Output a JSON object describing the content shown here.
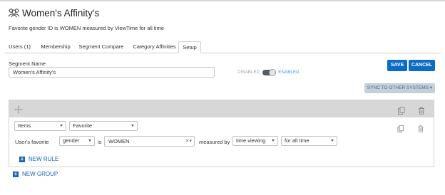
{
  "segment": {
    "title": "Women's Affinity's",
    "subtitle": "Favorite gender ID is WOMEN measured by ViewTime for all time",
    "title_icon": "group-icon"
  },
  "tabs": [
    {
      "label": "Users (1)",
      "active": false
    },
    {
      "label": "Membership",
      "active": false
    },
    {
      "label": "Segment Compare",
      "active": false
    },
    {
      "label": "Category Affinities",
      "active": false
    },
    {
      "label": "Setup",
      "active": true
    }
  ],
  "form": {
    "name_label": "Segment Name",
    "name_value": "Women's Affinity's",
    "toggle_off_label": "DISABLED",
    "toggle_on_label": "ENABLED",
    "toggle_state": "enabled"
  },
  "actions": {
    "save": "SAVE",
    "cancel": "CANCEL",
    "sync": "SYNC TO OTHER SYSTEMS ▾"
  },
  "rule_group": {
    "type_select": "Items",
    "mode_select": "Favorite",
    "condition": {
      "prefix": "User's favorite",
      "attribute": "gender",
      "operator": "is",
      "value": "WOMEN",
      "clear_symbol": "✕▾",
      "measured_by_label": "measured by",
      "metric": "time viewing",
      "period": "for all time"
    },
    "new_rule": "NEW RULE"
  },
  "new_group": "NEW GROUP",
  "colors": {
    "primary": "#0a6cc7",
    "link": "#1a63b8",
    "header_gray": "#d7d7d7"
  }
}
